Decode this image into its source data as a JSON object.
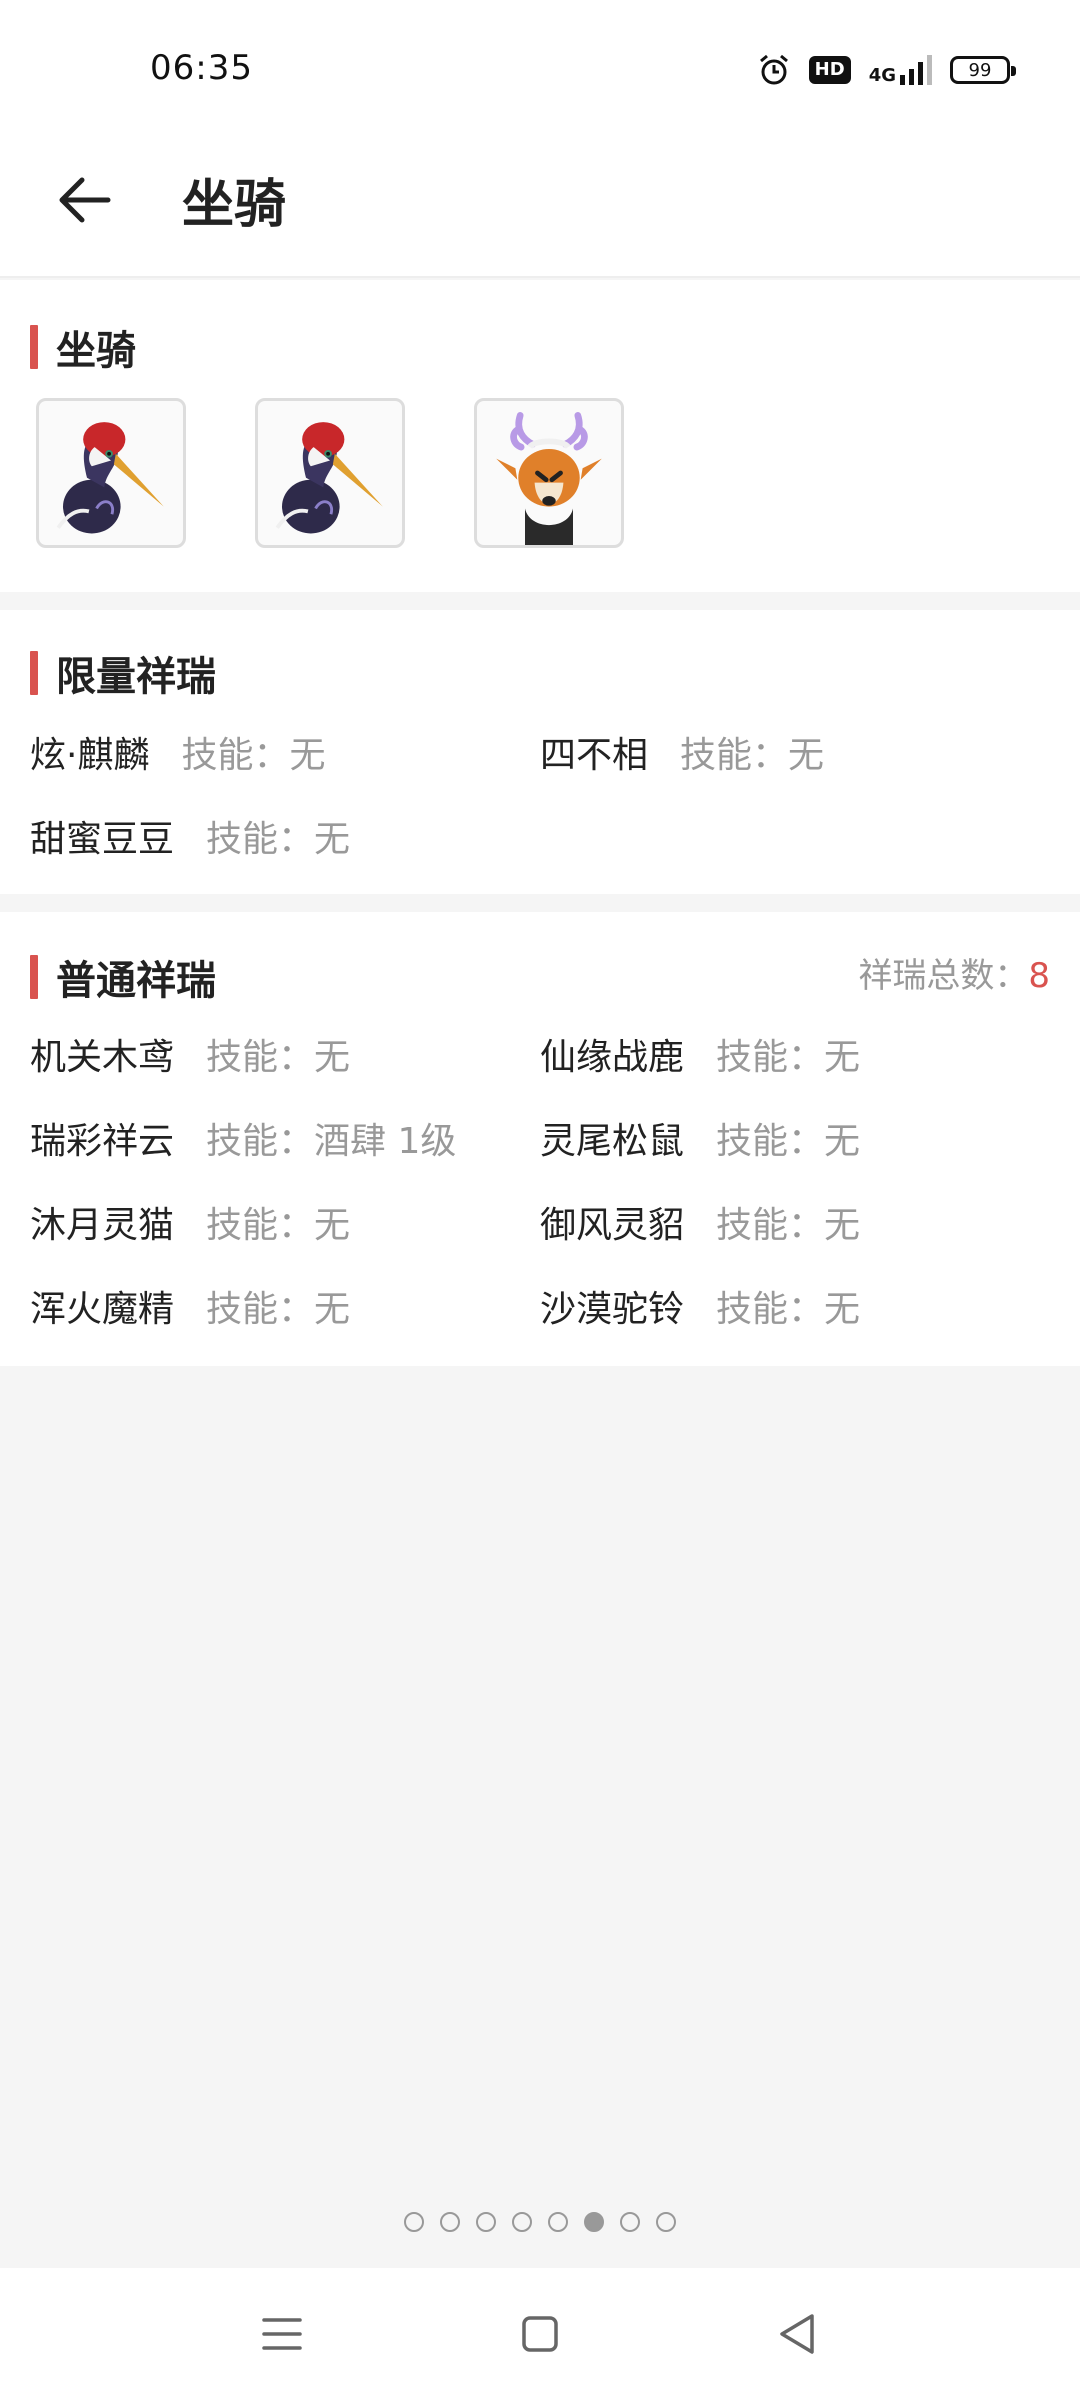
{
  "status_bar": {
    "time": "06:35",
    "hd_badge": "HD",
    "network": "4G",
    "battery": "99"
  },
  "header": {
    "title": "坐骑"
  },
  "mounts_section": {
    "title": "坐骑",
    "mounts": [
      "crane-mount-icon",
      "crane-mount-icon",
      "deer-mount-icon"
    ]
  },
  "limited_section": {
    "title": "限量祥瑞",
    "items": [
      {
        "name": "炫·麒麟",
        "skill": "技能：无"
      },
      {
        "name": "四不相",
        "skill": "技能：无"
      },
      {
        "name": "甜蜜豆豆",
        "skill": "技能：无"
      }
    ]
  },
  "normal_section": {
    "title": "普通祥瑞",
    "total_label": "祥瑞总数：",
    "total_value": "8",
    "items": [
      {
        "name": "机关木鸢",
        "skill": "技能：无"
      },
      {
        "name": "仙缘战鹿",
        "skill": "技能：无"
      },
      {
        "name": "瑞彩祥云",
        "skill": "技能：酒肆 1级"
      },
      {
        "name": "灵尾松鼠",
        "skill": "技能：无"
      },
      {
        "name": "沐月灵猫",
        "skill": "技能：无"
      },
      {
        "name": "御风灵貂",
        "skill": "技能：无"
      },
      {
        "name": "浑火魔精",
        "skill": "技能：无"
      },
      {
        "name": "沙漠驼铃",
        "skill": "技能：无"
      }
    ]
  },
  "pager": {
    "total": 8,
    "active_index": 5
  },
  "colors": {
    "accent": "#d9534f",
    "muted_text": "#999999"
  }
}
